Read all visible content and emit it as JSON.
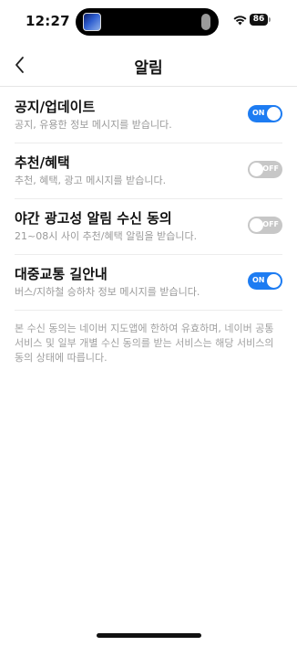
{
  "status_bar": {
    "time": "12:27",
    "battery": "86"
  },
  "header": {
    "title": "알림"
  },
  "settings": [
    {
      "title": "공지/업데이트",
      "desc": "공지, 유용한 정보 메시지를 받습니다.",
      "state": "on",
      "toggle_label": "ON"
    },
    {
      "title": "추천/혜택",
      "desc": "추천, 혜택, 광고 메시지를 받습니다.",
      "state": "off",
      "toggle_label": "OFF"
    },
    {
      "title": "야간 광고성 알림 수신 동의",
      "desc": "21~08시 사이 추천/혜택 알림을 받습니다.",
      "state": "off",
      "toggle_label": "OFF"
    },
    {
      "title": "대중교통 길안내",
      "desc": "버스/지하철 승하차 정보 메시지를 받습니다.",
      "state": "on",
      "toggle_label": "ON"
    }
  ],
  "footer_note": "본 수신 동의는 네이버 지도앱에 한하여 유효하며, 네이버 공통 서비스 및 일부 개별 수신 동의를 받는 서비스는 해당 서비스의 동의 상태에 따릅니다.",
  "colors": {
    "toggle_on": "#1d7cf2",
    "toggle_off": "#c7c7c7"
  }
}
